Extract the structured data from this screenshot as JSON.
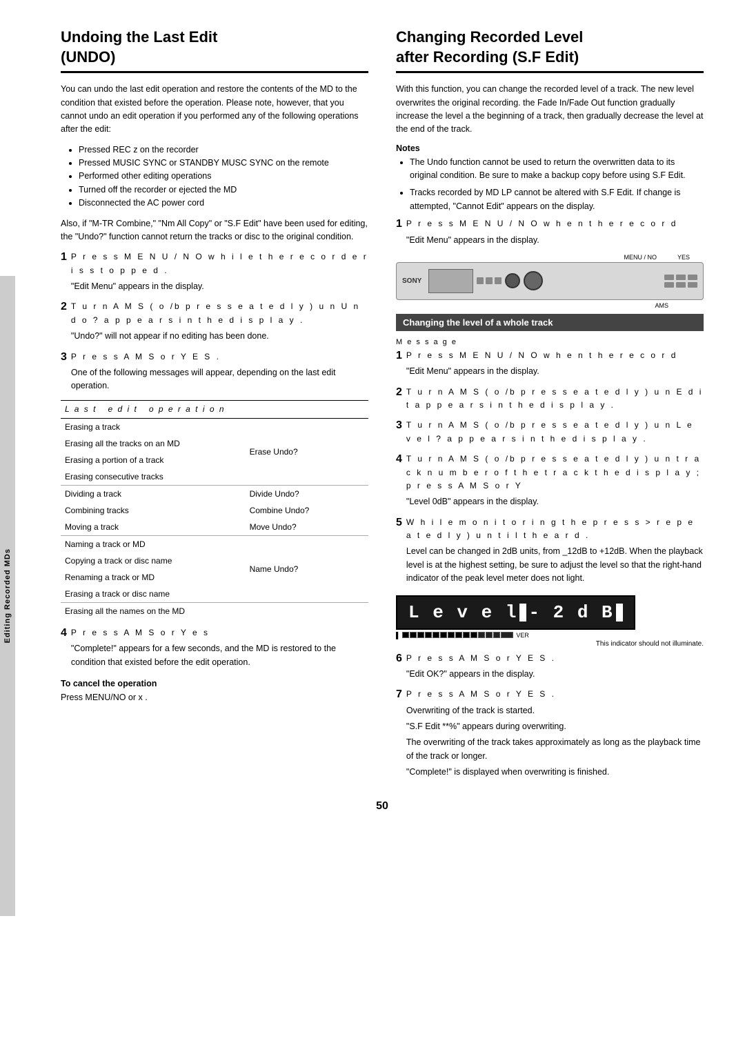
{
  "page": {
    "number": "50",
    "sidebar_label": "Editing Recorded MDs"
  },
  "left_section": {
    "title_line1": "Undoing the Last Edit",
    "title_line2": "(UNDO)",
    "intro": "You can undo the last edit operation and restore the contents of the MD to the condition that existed before the operation. Please note, however, that you cannot undo an edit operation if you performed any of the following operations after the edit:",
    "bullets": [
      "Pressed REC z  on the recorder",
      "Pressed MUSIC SYNC or STANDBY MUSC SYNC on the remote",
      "Performed other editing operations",
      "Turned off the recorder or ejected the MD",
      "Disconnected the AC power cord"
    ],
    "also_text": "Also, if \"M-TR Combine,\" \"Nm All Copy\" or \"S.F Edit\" have been used for editing, the \"Undo?\" function cannot return the tracks or disc to the original condition.",
    "steps": [
      {
        "num": "1",
        "text": "P r e s s M E N U / N O  w h i l e  t h e  r e c o r d e r  i s  s t o p p e d .",
        "note": "\"Edit Menu\" appears in the display."
      },
      {
        "num": "2",
        "text": "T u r n  A M S ( o  /b p r e s s e a t e d  l  y ) u n  U n d o  ? a p  p e a r s  i n  t h e  d i s p l a y .",
        "note": "\"Undo?\" will not appear if no editing has been done."
      },
      {
        "num": "3",
        "text": "P r e s s  A M  S o  r  Y  E S .",
        "note": "One of the following messages will appear, depending on the last edit operation."
      }
    ],
    "table": {
      "header": [
        "L a s t  e d i t  o p e r a t i o n",
        ""
      ],
      "rows": [
        [
          "Erasing a track",
          ""
        ],
        [
          "Erasing all the tracks on an MD",
          "Erase Undo?"
        ],
        [
          "Erasing a portion of a track",
          ""
        ],
        [
          "Erasing consecutive tracks",
          ""
        ],
        [
          "Dividing a track",
          "Divide Undo?"
        ],
        [
          "Combining tracks",
          "Combine Undo?"
        ],
        [
          "Moving a track",
          "Move Undo?"
        ],
        [
          "Naming a track or MD",
          ""
        ],
        [
          "Copying a track or disc name",
          ""
        ],
        [
          "Renaming a track or MD",
          "Name Undo?"
        ],
        [
          "Erasing a track or disc name",
          ""
        ],
        [
          "Erasing all the names on the MD",
          ""
        ]
      ]
    },
    "step4": {
      "num": "4",
      "text": "P r e s s  A M  S o  r  Y  e s",
      "note": "\"Complete!\" appears for a few seconds, and the MD is restored to the condition that existed before the edit operation."
    },
    "to_cancel_heading": "To cancel the operation",
    "to_cancel_text": "Press MENU/NO or x ."
  },
  "right_section": {
    "title_line1": "Changing Recorded Level",
    "title_line2": "after Recording (S.F Edit)",
    "intro": "With this function, you can change the recorded level of a track. The new level overwrites the original recording. the Fade In/Fade Out function gradually increase the level a the beginning of a track, then gradually decrease the level at the end of the track.",
    "notes_heading": "Notes",
    "notes": [
      "The Undo function cannot be used to return the overwritten data to its original condition. Be sure to make a backup copy before using S.F Edit.",
      "Tracks recorded by MD LP cannot be altered with S.F Edit. If change is attempted, \"Cannot Edit\" appears on the display."
    ],
    "step1": {
      "num": "1",
      "text": "P r e s s  M E N U / N O  w h e n  t h e r e c o r d",
      "note": "\"Edit Menu\" appears in the display."
    },
    "diagram_labels": {
      "menu_no": "MENU / NO",
      "yes": "YES",
      "ams": "AMS"
    },
    "subsection_title": "Changing the level of a whole track",
    "step_msg": "M e s s a g e",
    "steps_right": [
      {
        "num": "1",
        "text": "P r e s s  M E N U / N O  w h e n  t h e  r e c  o  r d",
        "note": "\"Edit Menu\" appears in the display."
      },
      {
        "num": "2",
        "text": "T u r n  A M S ( o  /b p r e s s e a t e d  l  y ) u n  E d i t  a p  p e a r s  i n  t h e  d i s p l a y .",
        "note": ""
      },
      {
        "num": "3",
        "text": "T u r n  A M S ( o  /b p r e s s e a t e d  l  y ) u n  L e v e l  ? a p  p e a r s  i n  t h e  d i s p l a y .",
        "note": ""
      },
      {
        "num": "4",
        "text": "T u r n  A M S ( o  /b p r e s s e a t e d  l  y ) u n  t r a c k  n u m b e r  o f  t h e  t r a c k  t h e  d i s p l a y ;  p r e s s  A M  S o r  Y",
        "note": "\"Level 0dB\" appears in the display."
      },
      {
        "num": "5",
        "text": "W h i l e  m o n i t o r i n g  t h e  p r e s s >  r e p  e a t e d  l  y ) u n t i l  t  h e a r d .",
        "note": "Level can be changed in 2dB units, from _12dB to +12dB. When the playback level is at the highest setting, be sure to adjust the level so that the right-hand indicator of the peak level meter does not light."
      }
    ],
    "level_display": {
      "text": "L e v e l  -2dB",
      "display_text": "Level■-2dB■"
    },
    "meter_note": "This indicator should not illuminate.",
    "step6": {
      "num": "6",
      "text": "P r e s s  A M  S o  r  Y  E S .",
      "note": "\"Edit OK?\" appears in the display."
    },
    "step7": {
      "num": "7",
      "text": "P r e s s  A M  S o  r  Y  E S .",
      "note1": "Overwriting of the track is started.",
      "note2": "\"S.F Edit **%\" appears during overwriting.",
      "note3": "The overwriting of the track takes approximately as long as the playback time of the track or longer.",
      "note4": "\"Complete!\" is displayed when overwriting is finished."
    }
  }
}
